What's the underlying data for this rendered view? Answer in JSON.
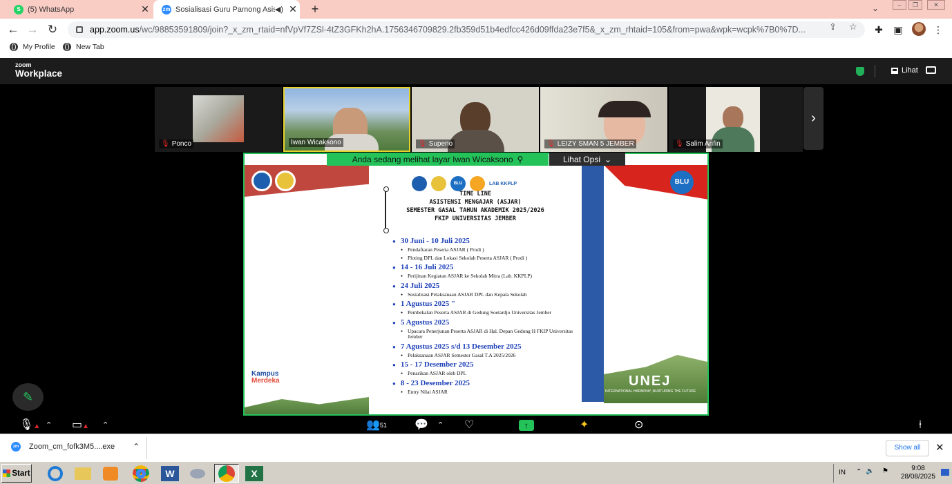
{
  "browser": {
    "tabs": [
      {
        "title": "(5) WhatsApp",
        "icon": "whatsapp-icon",
        "color": "#25d366"
      },
      {
        "title": "Sosialisasi Guru Pamong Asisten",
        "icon": "zoom-icon",
        "color": "#2d8cff"
      }
    ],
    "url_host": "app.zoom.us",
    "url_path": "/wc/98853591809/join?_x_zm_rtaid=nfVpVf7ZSl-4tZ3GFKh2hA.1756346709829.2fb359d51b4edfcc426d09ffda23e7f5&_x_zm_rhtaid=105&from=pwa&wpk=wcpk%7B0%7D...",
    "bookmarks": [
      "My Profile",
      "New Tab"
    ]
  },
  "zoom": {
    "logo_top": "zoom",
    "logo_bottom": "Workplace",
    "view_label": "Lihat",
    "participants": [
      "Ponco",
      "Iwan Wicaksono",
      "Supeno",
      "LEIZY SMAN 5 JEMBER",
      "Salim Arifin"
    ],
    "share_banner": "Anda sedang melihat layar  Iwan Wicaksono",
    "view_options": "Lihat Opsi",
    "participant_count": "51"
  },
  "slide": {
    "lab_label": "LAB KKPLP",
    "blu_label": "BLU",
    "kampus_top": "Kampus",
    "kampus_bottom": "Merdeka",
    "unej": "UNEJ",
    "unej_tagline": "INTERNATIONAL HARMONY, NURTURING THE FUTURE",
    "heading": [
      "TIME LINE",
      "ASISTENSI MENGAJAR (ASJAR)",
      "SEMESTER GASAL TAHUN AKADEMIK 2025/2026",
      "FKIP UNIVERSITAS JEMBER"
    ],
    "timeline": [
      {
        "date": "30 Juni - 10 Juli 2025",
        "items": [
          "Pendaftaran Peserta ASJAR ( Prodi )",
          "Ploting DPL dan Lokasi Sekolah Peserta ASJAR ( Prodi )"
        ]
      },
      {
        "date": "14 - 16 Juli 2025",
        "items": [
          "Perijinan Kegiatan ASJAR ke Sekolah Mitra (Lab. KKPLP)"
        ]
      },
      {
        "date": "24 Juli 2025",
        "items": [
          "Sosialisasi Pelaksanaan ASJAR DPL dan Kepala Sekolah"
        ]
      },
      {
        "date": "1 Agustus 2025 \"",
        "items": [
          "Pembekalan Peserta ASJAR di Gedung Soetardjo Universitas Jember"
        ]
      },
      {
        "date": "5 Agustus 2025",
        "items": [
          "Upacara Penerjunan Peserta ASJAR di Hal. Depan Gedung H FKIP Universitas Jember"
        ]
      },
      {
        "date": "7 Agustus 2025 s/d 13 Desember 2025",
        "items": [
          "Pelaksanaan ASJAR Semester Gasal T.A 2025/2026"
        ]
      },
      {
        "date": "15 - 17  Desember 2025",
        "items": [
          "Penarikan ASJAR oleh DPL"
        ]
      },
      {
        "date": "8 - 23 Desember 2025",
        "items": [
          "Entry Nilai ASJAR"
        ]
      }
    ]
  },
  "downloads": {
    "file": "Zoom_cm_fofk3M5....exe",
    "show_all": "Show all"
  },
  "taskbar": {
    "start": "Start",
    "lang": "IN",
    "time": "9:08",
    "date": "28/08/2025"
  }
}
